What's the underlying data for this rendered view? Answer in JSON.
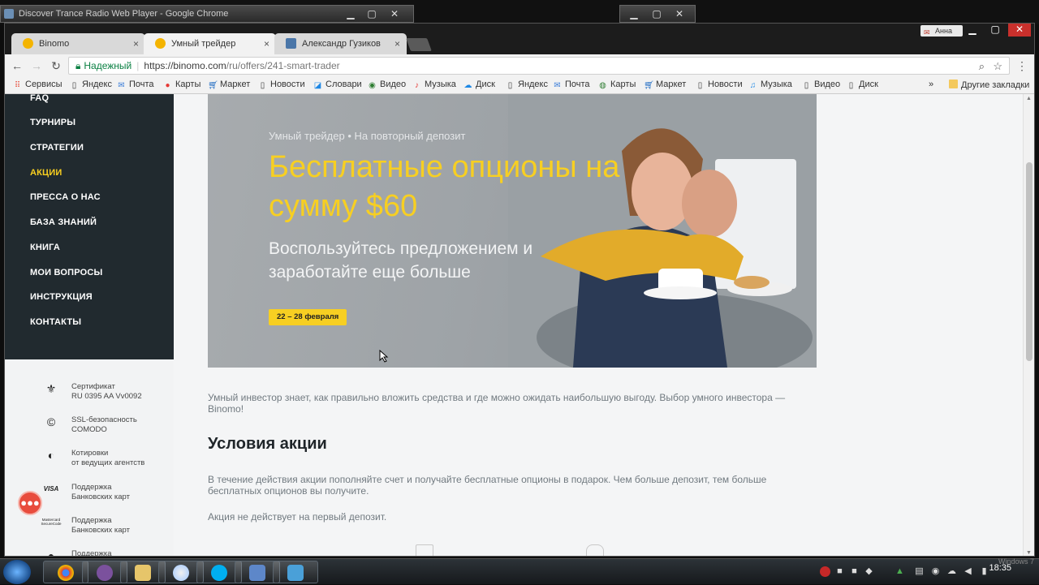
{
  "background_window": {
    "title": "Discover Trance Radio Web Player - Google Chrome"
  },
  "browser": {
    "profile_name": "Анна",
    "tabs": [
      {
        "label": "Binomo"
      },
      {
        "label": "Умный трейдер"
      },
      {
        "label": "Александр Гузиков"
      }
    ],
    "secure_label": "Надежный",
    "url_host": "https://binomo.com",
    "url_path": "/ru/offers/241-smart-trader",
    "bookmarks": [
      "Сервисы",
      "Яндекс",
      "Почта",
      "Карты",
      "Маркет",
      "Новости",
      "Словари",
      "Видео",
      "Музыка",
      "Диск",
      "Яндекс",
      "Почта",
      "Карты",
      "Маркет",
      "Новости",
      "Музыка",
      "Видео",
      "Диск"
    ],
    "bookmarks_more": "»",
    "other_bookmarks": "Другие закладки"
  },
  "sidebar": {
    "nav": [
      {
        "label": "FAQ"
      },
      {
        "label": "ТУРНИРЫ"
      },
      {
        "label": "СТРАТЕГИИ"
      },
      {
        "label": "АКЦИИ"
      },
      {
        "label": "ПРЕССА О НАС"
      },
      {
        "label": "БАЗА ЗНАНИЙ"
      },
      {
        "label": "КНИГА"
      },
      {
        "label": "МОИ ВОПРОСЫ"
      },
      {
        "label": "ИНСТРУКЦИЯ"
      },
      {
        "label": "КОНТАКТЫ"
      }
    ],
    "active_color": "#f9cf1f",
    "features": [
      {
        "line1": "Сертификат",
        "line2": "RU 0395 AA Vv0092",
        "icon": "certificate-icon"
      },
      {
        "line1": "SSL-безопасность",
        "line2": "COMODO",
        "icon": "comodo-icon"
      },
      {
        "line1": "Котировки",
        "line2": "от ведущих агентств",
        "icon": "quotes-icon"
      },
      {
        "line1": "Поддержка",
        "line2": "Банковских карт",
        "icon": "visa-icon",
        "icon_text": "VISA"
      },
      {
        "line1": "Поддержка",
        "line2": "Банковских карт",
        "icon": "mastercard-icon",
        "icon_text": "Mastercard SecureCode"
      },
      {
        "line1": "Поддержка",
        "line2": "",
        "icon": "apple-icon"
      }
    ]
  },
  "banner": {
    "subtitle": "Умный трейдер • На повторный депозит",
    "title": "Бесплатные опционы на сумму $60",
    "text": "Воспользуйтесь предложением и заработайте еще больше",
    "badge": "22 – 28 февраля",
    "accent": "#f7cf22"
  },
  "content": {
    "intro": "Умный инвестор знает, как правильно вложить средства и где можно ожидать наибольшую выгоду. Выбор умного инвестора — Binomo!",
    "section_title": "Условия акции",
    "conditions": "В течение действия акции пополняйте счет и получайте бесплатные опционы в подарок. Чем больше депозит, тем больше бесплатных опционов вы получите.",
    "note": "Акция не действует на первый депозит."
  },
  "taskbar": {
    "clock": "18:35",
    "os_label": "Windows 7"
  }
}
